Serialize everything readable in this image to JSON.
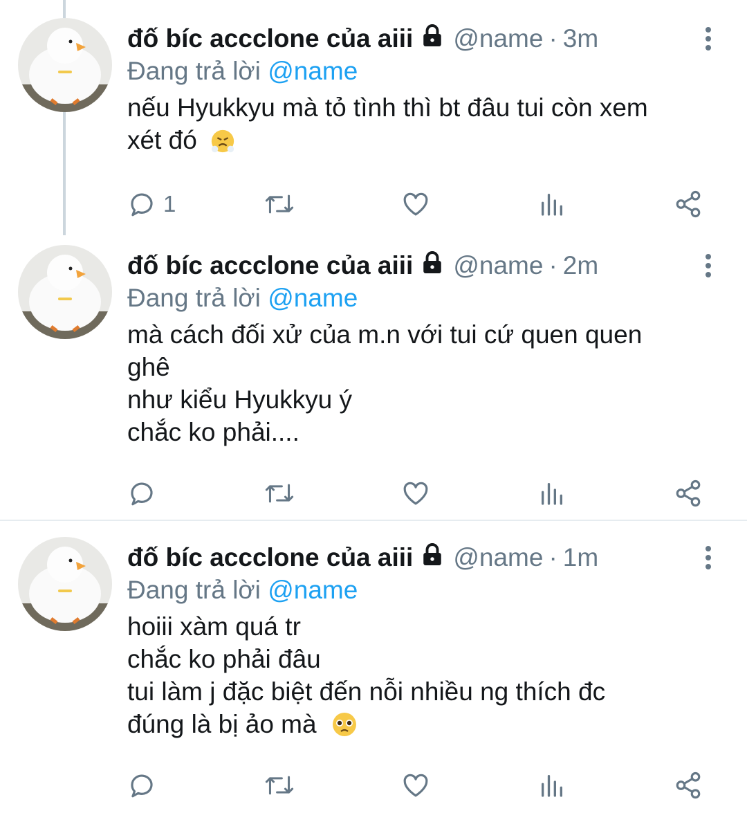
{
  "tweets": [
    {
      "author": "đố bíc accclone của aiii",
      "handle": "@name",
      "time": "3m",
      "replying_prefix": "Đang trả lời ",
      "replying_to": "@name",
      "lines": [
        "nếu Hyukkyu mà tỏ tình thì bt đâu tui còn xem",
        "xét đó"
      ],
      "emoji": "face-with-steam-icon",
      "reply_count": "1"
    },
    {
      "author": "đố bíc accclone của aiii",
      "handle": "@name",
      "time": "2m",
      "replying_prefix": "Đang trả lời ",
      "replying_to": "@name",
      "lines": [
        "mà cách đối xử của m.n với tui cứ quen quen",
        "ghê",
        "như kiểu Hyukkyu ý",
        "chắc ko phải...."
      ],
      "reply_count": ""
    },
    {
      "author": "đố bíc accclone của aiii",
      "handle": "@name",
      "time": "1m",
      "replying_prefix": "Đang trả lời ",
      "replying_to": "@name",
      "lines": [
        "hoiii xàm quá tr",
        "chắc ko phải đâu",
        "tui làm j đặc biệt đến nỗi nhiều ng thích đc",
        "đúng là bị ảo mà"
      ],
      "emoji": "pleading-face-icon",
      "reply_count": ""
    }
  ],
  "colors": {
    "text": "#14171a",
    "secondary": "#657786",
    "link": "#1da1f2",
    "divider": "#e6ecf0",
    "thread_line": "#ccd6dd"
  },
  "icons": [
    "avatar-duck",
    "lock-icon",
    "more-vertical-icon",
    "reply-icon",
    "retweet-icon",
    "like-icon",
    "analytics-icon",
    "share-icon"
  ]
}
